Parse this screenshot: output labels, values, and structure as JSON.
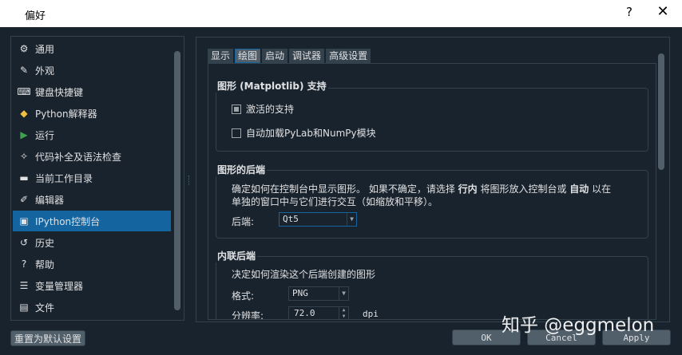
{
  "window": {
    "title": "偏好",
    "help": "?",
    "close": "✕"
  },
  "sidebar": {
    "items": [
      {
        "label": "通用",
        "icon": "⚙"
      },
      {
        "label": "外观",
        "icon": "✎"
      },
      {
        "label": "键盘快捷键",
        "icon": "⌨"
      },
      {
        "label": "Python解释器",
        "icon": "◆"
      },
      {
        "label": "运行",
        "icon": "▶"
      },
      {
        "label": "代码补全及语法检查",
        "icon": "✧"
      },
      {
        "label": "当前工作目录",
        "icon": "▬"
      },
      {
        "label": "编辑器",
        "icon": "✐"
      },
      {
        "label": "IPython控制台",
        "icon": "▣"
      },
      {
        "label": "历史",
        "icon": "↺"
      },
      {
        "label": "帮助",
        "icon": "?"
      },
      {
        "label": "变量管理器",
        "icon": "☰"
      },
      {
        "label": "文件",
        "icon": "▤"
      }
    ],
    "selected_index": 8
  },
  "reset_button": "重置为默认设置",
  "tabs": [
    "显示",
    "绘图",
    "启动",
    "调试器",
    "高级设置"
  ],
  "active_tab": 1,
  "graphics_group": {
    "title": "图形 (Matplotlib) 支持",
    "activate_label": "激活的支持",
    "activate_checked": true,
    "autoload_label": "自动加载PyLab和NumPy模块",
    "autoload_checked": false
  },
  "backend_group": {
    "title": "图形的后端",
    "desc_part1": "确定如何在控制台中显示图形。 如果不确定，请选择 ",
    "desc_bold1": "行内",
    "desc_part2": " 将图形放入控制台或 ",
    "desc_bold2": "自动",
    "desc_part3": " 以在",
    "desc_line2": "单独的窗口中与它们进行交互（如缩放和平移）。",
    "backend_label": "后端:",
    "backend_value": "Qt5"
  },
  "inline_group": {
    "title": "内联后端",
    "desc": "决定如何渲染这个后端创建的图形",
    "format_label": "格式:",
    "format_value": "PNG",
    "resolution_label": "分辨率:",
    "resolution_value": "72.0",
    "resolution_unit": "dpi"
  },
  "buttons": {
    "ok": "OK",
    "cancel": "Cancel",
    "apply": "Apply"
  },
  "watermark": "知乎 @eggmelon"
}
